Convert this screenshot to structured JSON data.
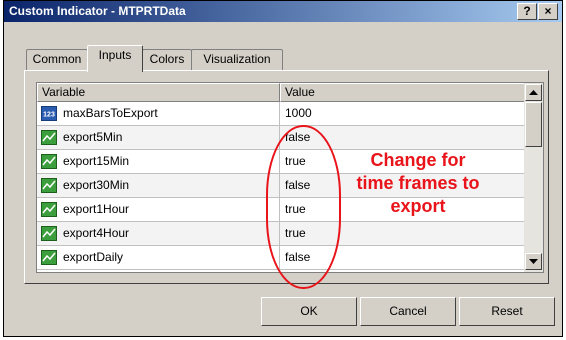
{
  "window": {
    "title": "Custom Indicator - MTPRTData",
    "help_glyph": "?",
    "close_glyph": "×"
  },
  "tabs": [
    {
      "label": "Common"
    },
    {
      "label": "Inputs",
      "active": true
    },
    {
      "label": "Colors"
    },
    {
      "label": "Visualization"
    }
  ],
  "grid": {
    "columns": {
      "variable": "Variable",
      "value": "Value"
    },
    "rows": [
      {
        "icon": "numeric-123-icon",
        "icon_text": "123",
        "name": "maxBarsToExport",
        "value": "1000"
      },
      {
        "icon": "boolean-chart-icon",
        "name": "export5Min",
        "value": "false"
      },
      {
        "icon": "boolean-chart-icon",
        "name": "export15Min",
        "value": "true"
      },
      {
        "icon": "boolean-chart-icon",
        "name": "export30Min",
        "value": "false"
      },
      {
        "icon": "boolean-chart-icon",
        "name": "export1Hour",
        "value": "true"
      },
      {
        "icon": "boolean-chart-icon",
        "name": "export4Hour",
        "value": "true"
      },
      {
        "icon": "boolean-chart-icon",
        "name": "exportDaily",
        "value": "false"
      }
    ]
  },
  "annotation": {
    "lines": [
      "Change for",
      "time frames to",
      "export"
    ],
    "color": "#e8141a"
  },
  "buttons": {
    "ok": "OK",
    "cancel": "Cancel",
    "reset": "Reset"
  },
  "colors": {
    "title_start": "#0a246a",
    "title_end": "#a6caf0",
    "face": "#d4d0c8"
  }
}
